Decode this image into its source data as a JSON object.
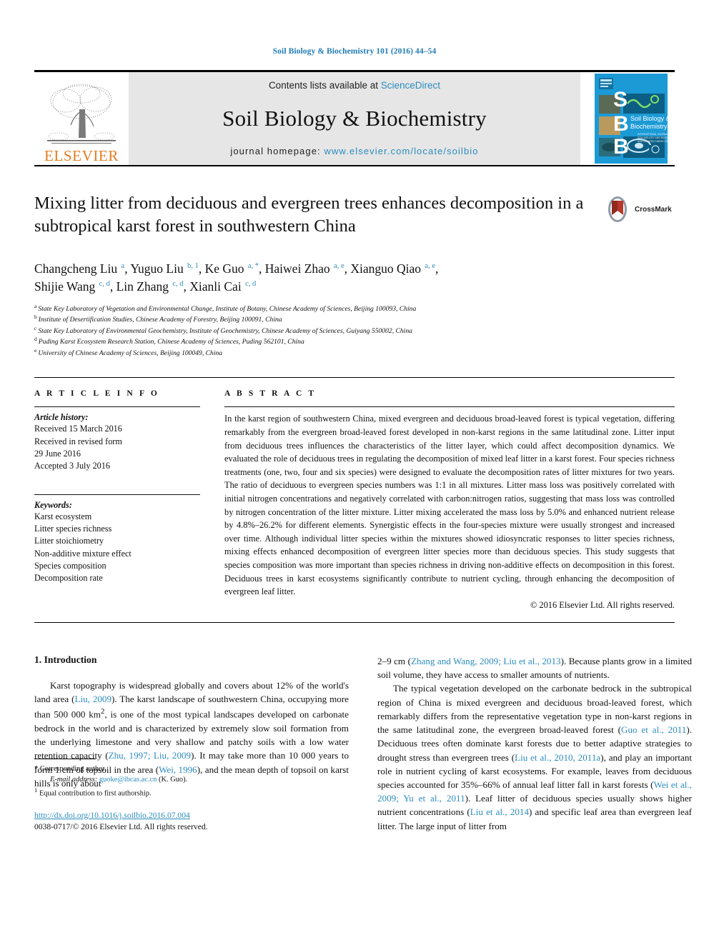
{
  "running_head": "Soil Biology & Biochemistry 101 (2016) 44–54",
  "masthead": {
    "publisher_name": "ELSEVIER",
    "contents_prefix": "Contents lists available at ",
    "sciencedirect": "ScienceDirect",
    "journal_title": "Soil Biology & Biochemistry",
    "homepage_prefix": "journal homepage: ",
    "homepage_url": "www.elsevier.com/locate/soilbio",
    "cover_letters": [
      "S",
      "B",
      "B"
    ],
    "cover_caption_line1": "Soil Biology &",
    "cover_caption_line2": "Biochemistry",
    "colors": {
      "elsevier_orange": "#E87B1E",
      "link_blue": "#2b8cbe",
      "cover_blue": "#1b9ad6",
      "masthead_grey": "#e6e6e6"
    }
  },
  "crossmark": {
    "label": "CrossMark"
  },
  "article": {
    "title": "Mixing litter from deciduous and evergreen trees enhances decomposition in a subtropical karst forest in southwestern China",
    "authors_line1_parts": [
      {
        "name": "Changcheng Liu",
        "sup": "a",
        "sep": ", "
      },
      {
        "name": "Yuguo Liu",
        "sup": "b, 1",
        "sep": ", "
      },
      {
        "name": "Ke Guo",
        "sup": "a, *",
        "sep": ", "
      },
      {
        "name": "Haiwei Zhao",
        "sup": "a, e",
        "sep": ", "
      },
      {
        "name": "Xianguo Qiao",
        "sup": "a, e",
        "sep": ","
      }
    ],
    "authors_line2_parts": [
      {
        "name": "Shijie Wang",
        "sup": "c, d",
        "sep": ", "
      },
      {
        "name": "Lin Zhang",
        "sup": "c, d",
        "sep": ", "
      },
      {
        "name": "Xianli Cai",
        "sup": "c, d",
        "sep": ""
      }
    ],
    "affiliations": [
      {
        "marker": "a",
        "text": "State Key Laboratory of Vegetation and Environmental Change, Institute of Botany, Chinese Academy of Sciences, Beijing 100093, China"
      },
      {
        "marker": "b",
        "text": "Institute of Desertification Studies, Chinese Academy of Forestry, Beijing 100091, China"
      },
      {
        "marker": "c",
        "text": "State Key Laboratory of Environmental Geochemistry, Institute of Geochemistry, Chinese Academy of Sciences, Guiyang 550002, China"
      },
      {
        "marker": "d",
        "text": "Puding Karst Ecosystem Research Station, Chinese Academy of Sciences, Puding 562101, China"
      },
      {
        "marker": "e",
        "text": "University of Chinese Academy of Sciences, Beijing 100049, China"
      }
    ]
  },
  "article_info": {
    "heading": "A R T I C L E   I N F O",
    "history_label": "Article history:",
    "history_lines": [
      "Received 15 March 2016",
      "Received in revised form",
      "29 June 2016",
      "Accepted 3 July 2016"
    ],
    "keywords_label": "Keywords:",
    "keywords": [
      "Karst ecosystem",
      "Litter species richness",
      "Litter stoichiometry",
      "Non-additive mixture effect",
      "Species composition",
      "Decomposition rate"
    ]
  },
  "abstract": {
    "heading": "A B S T R A C T",
    "text": "In the karst region of southwestern China, mixed evergreen and deciduous broad-leaved forest is typical vegetation, differing remarkably from the evergreen broad-leaved forest developed in non-karst regions in the same latitudinal zone. Litter input from deciduous trees influences the characteristics of the litter layer, which could affect decomposition dynamics. We evaluated the role of deciduous trees in regulating the decomposition of mixed leaf litter in a karst forest. Four species richness treatments (one, two, four and six species) were designed to evaluate the decomposition rates of litter mixtures for two years. The ratio of deciduous to evergreen species numbers was 1:1 in all mixtures. Litter mass loss was positively correlated with initial nitrogen concentrations and negatively correlated with carbon:nitrogen ratios, suggesting that mass loss was controlled by nitrogen concentration of the litter mixture. Litter mixing accelerated the mass loss by 5.0% and enhanced nutrient release by 4.8%–26.2% for different elements. Synergistic effects in the four-species mixture were usually strongest and increased over time. Although individual litter species within the mixtures showed idiosyncratic responses to litter species richness, mixing effects enhanced decomposition of evergreen litter species more than deciduous species. This study suggests that species composition was more important than species richness in driving non-additive effects on decomposition in this forest. Deciduous trees in karst ecosystems significantly contribute to nutrient cycling, through enhancing the decomposition of evergreen leaf litter.",
    "copyright": "© 2016 Elsevier Ltd. All rights reserved."
  },
  "introduction": {
    "section_number": "1.",
    "section_title": "Introduction",
    "left_paragraph_segments": [
      {
        "t": "Karst topography is widespread globally and covers about 12% of the world's land area (",
        "k": "plain"
      },
      {
        "t": "Liu, 2009",
        "k": "ref"
      },
      {
        "t": "). The karst landscape of southwestern China, occupying more than 500 000 km",
        "k": "plain"
      },
      {
        "t": "2",
        "k": "sup"
      },
      {
        "t": ", is one of the most typical landscapes developed on carbonate bedrock in the world and is characterized by extremely slow soil formation from the underlying limestone and very shallow and patchy soils with a low water retention capacity (",
        "k": "plain"
      },
      {
        "t": "Zhu, 1997; Liu, 2009",
        "k": "ref"
      },
      {
        "t": "). It may take more than 10 000 years to form 1 cm of topsoil in the area (",
        "k": "plain"
      },
      {
        "t": "Wei, 1996",
        "k": "ref"
      },
      {
        "t": "), and the mean depth of topsoil on karst hills is only about ",
        "k": "plain"
      }
    ],
    "right_paragraph1_segments": [
      {
        "t": "2–9 cm (",
        "k": "plain"
      },
      {
        "t": "Zhang and Wang, 2009; Liu et al., 2013",
        "k": "ref"
      },
      {
        "t": "). Because plants grow in a limited soil volume, they have access to smaller amounts of nutrients.",
        "k": "plain"
      }
    ],
    "right_paragraph2_segments": [
      {
        "t": "The typical vegetation developed on the carbonate bedrock in the subtropical region of China is mixed evergreen and deciduous broad-leaved forest, which remarkably differs from the representative vegetation type in non-karst regions in the same latitudinal zone, the evergreen broad-leaved forest (",
        "k": "plain"
      },
      {
        "t": "Guo et al., 2011",
        "k": "ref"
      },
      {
        "t": "). Deciduous trees often dominate karst forests due to better adaptive strategies to drought stress than evergreen trees (",
        "k": "plain"
      },
      {
        "t": "Liu et al., 2010, 2011a",
        "k": "ref"
      },
      {
        "t": "), and play an important role in nutrient cycling of karst ecosystems. For example, leaves from deciduous species accounted for 35%–66% of annual leaf litter fall in karst forests (",
        "k": "plain"
      },
      {
        "t": "Wei et al., 2009; Yu et al., 2011",
        "k": "ref"
      },
      {
        "t": "). Leaf litter of deciduous species usually shows higher nutrient concentrations (",
        "k": "plain"
      },
      {
        "t": "Liu et al., 2014",
        "k": "ref"
      },
      {
        "t": ") and specific leaf area than evergreen leaf litter. The large input of litter from",
        "k": "plain"
      }
    ]
  },
  "footnotes": {
    "corresponding_marker": "*",
    "corresponding_text": "Corresponding author.",
    "email_label": "E-mail address:",
    "email": "guoke@ibcas.ac.cn",
    "email_suffix": "(K. Guo).",
    "equal_marker": "1",
    "equal_text": "Equal contribution to first authorship.",
    "doi_url": "http://dx.doi.org/10.1016/j.soilbio.2016.07.004",
    "issn_line": "0038-0717/© 2016 Elsevier Ltd. All rights reserved."
  }
}
